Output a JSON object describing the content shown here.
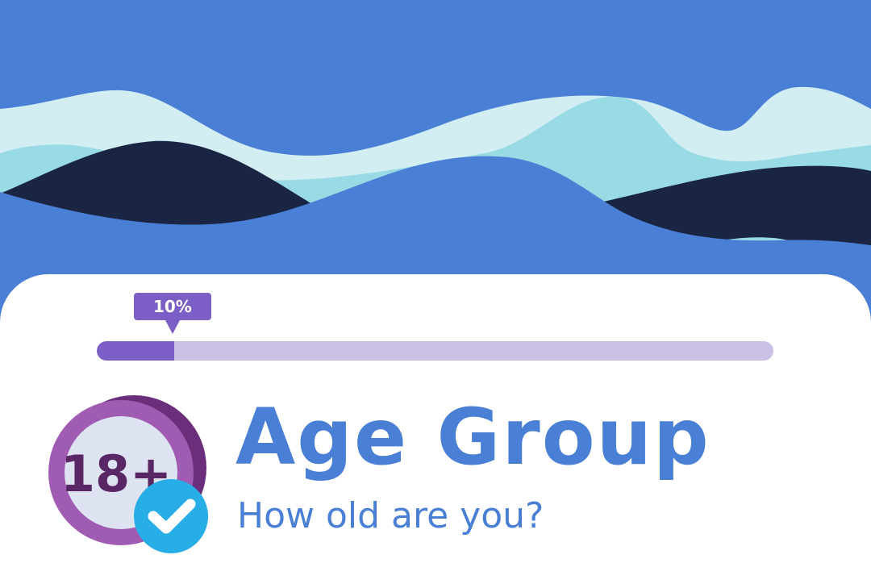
{
  "progress": {
    "percent": 10,
    "label": "10%"
  },
  "question": {
    "title": "Age Group",
    "subtitle": "How old are you?"
  },
  "icon": {
    "name": "age-18-plus-verified-icon",
    "text": "18+"
  },
  "colors": {
    "background": "#4a7fd6",
    "wave_light": "#d2eef3",
    "wave_teal": "#98dbe4",
    "wave_navy": "#1a2443",
    "progress_fill": "#7c5fc6",
    "progress_track": "#cbc0e6",
    "text_blue": "#4a7fd6",
    "badge_blue": "#27aee6"
  }
}
